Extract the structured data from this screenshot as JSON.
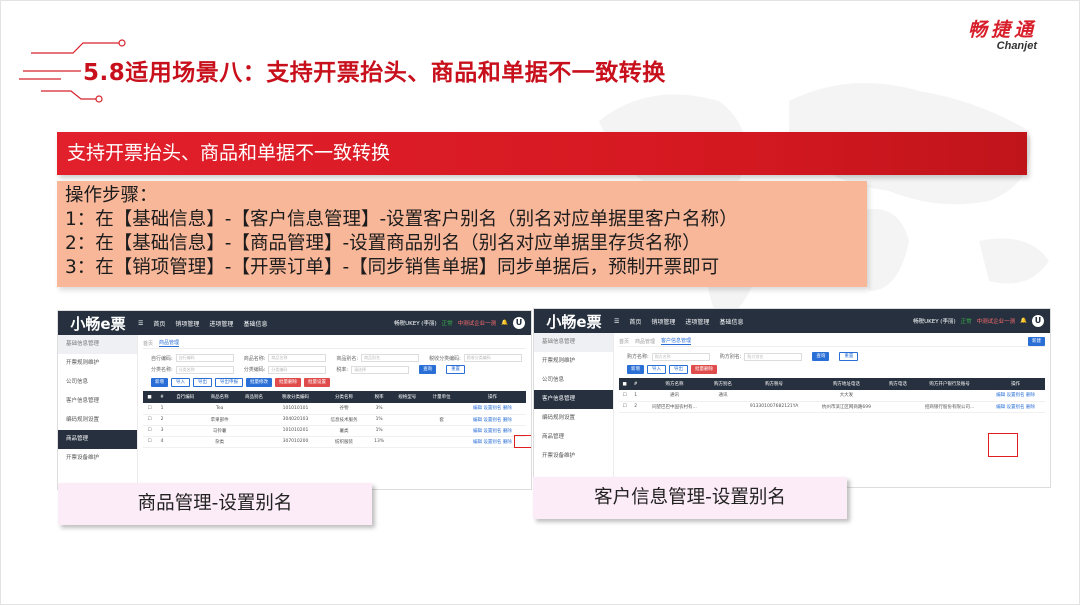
{
  "slide": {
    "logo_cn": "畅捷通",
    "logo_en": "Chanjet",
    "title": "5.8适用场景八：支持开票抬头、商品和单据不一致转换",
    "banner": "支持开票抬头、商品和单据不一致转换",
    "steps": [
      "操作步骤：",
      "1：在【基础信息】-【客户信息管理】-设置客户别名（别名对应单据里客户名称）",
      "2：在【基础信息】-【商品管理】-设置商品别名（别名对应单据里存货名称）",
      "3：在【销项管理】-【开票订单】-【同步销售单据】同步单据后，预制开票即可"
    ],
    "caption_left": "商品管理-设置别名",
    "caption_right": "客户信息管理-设置别名"
  },
  "app": {
    "brand": "小畅e票",
    "menu": [
      "首页",
      "销项管理",
      "进项管理",
      "基础信息"
    ],
    "ukey": "畅税UKEY (李丽)",
    "status": "正常",
    "org": "中测试企业一测",
    "avatar": "U"
  },
  "left_screen": {
    "side": [
      "基础信息管理",
      "开票规则维护",
      "公司信息",
      "客户信息管理",
      "编码规则设置",
      "商品管理",
      "开票设备维护"
    ],
    "tabs": [
      "首页",
      "商品管理"
    ],
    "filters": [
      {
        "label": "自行编码:",
        "ph": "自行编码"
      },
      {
        "label": "商品名称:",
        "ph": "商品名称"
      },
      {
        "label": "商品别名:",
        "ph": "商品别名"
      },
      {
        "label": "税收分类编码:",
        "ph": "税收分类编码"
      },
      {
        "label": "分类名称:",
        "ph": "分类名称"
      },
      {
        "label": "分类编码:",
        "ph": "分类编码"
      },
      {
        "label": "税率:",
        "ph": "请选择"
      }
    ],
    "search_btn": "查询",
    "reset_btn": "重置",
    "buttons": [
      "新增",
      "导入",
      "导出",
      "导出申报",
      "批量修改",
      "批量删除",
      "批量设置"
    ],
    "columns": [
      "#",
      "自行编码",
      "商品名称",
      "商品别名",
      "税收分类编码",
      "分类名称",
      "税率",
      "规格型号",
      "计量单位",
      "操作"
    ],
    "rows": [
      [
        "1",
        "",
        "Tea",
        "",
        "101010101",
        "谷物",
        "3%",
        "",
        "",
        "编辑 设置别名 删除"
      ],
      [
        "2",
        "",
        "苹果部件",
        "",
        "304020103",
        "信息技术服务",
        "1%",
        "",
        "套",
        "编辑 设置别名 删除"
      ],
      [
        "3",
        "",
        "马铃薯",
        "",
        "101010201",
        "薯类",
        "1%",
        "",
        "",
        "编辑 设置别名 删除"
      ],
      [
        "4",
        "",
        "杂类",
        "",
        "307010200",
        "纺织服装",
        "13%",
        "",
        "",
        "编辑 设置别名 删除"
      ]
    ]
  },
  "right_screen": {
    "side": [
      "基础信息管理",
      "开票规则维护",
      "公司信息",
      "客户信息管理",
      "编码规则设置",
      "商品管理",
      "开票设备维护"
    ],
    "tabs": [
      "首页",
      "商品管理",
      "客户信息管理"
    ],
    "filters": [
      {
        "label": "购方名称:",
        "ph": "购方名称"
      },
      {
        "label": "购方别名:",
        "ph": "购方别名"
      }
    ],
    "search_btn": "查询",
    "reset_btn": "重置",
    "new_btn": "新建",
    "buttons": [
      "新增",
      "导入",
      "导出",
      "批量删除"
    ],
    "columns": [
      "#",
      "购方名称",
      "购方别名",
      "购方税号",
      "购方地址电话",
      "购方电话",
      "购方开户银行及账号",
      "操作"
    ],
    "rows": [
      [
        "1",
        "通讯",
        "通讯",
        "",
        "大大发",
        "",
        "",
        "编辑 设置别名 删除"
      ],
      [
        "2",
        "同望巴巴中国农村有...",
        "",
        "913301007682121YA",
        "杭州市滨江区网商路699",
        "",
        "招商银行股份有限公司...",
        "编辑 设置别名 删除"
      ]
    ]
  }
}
